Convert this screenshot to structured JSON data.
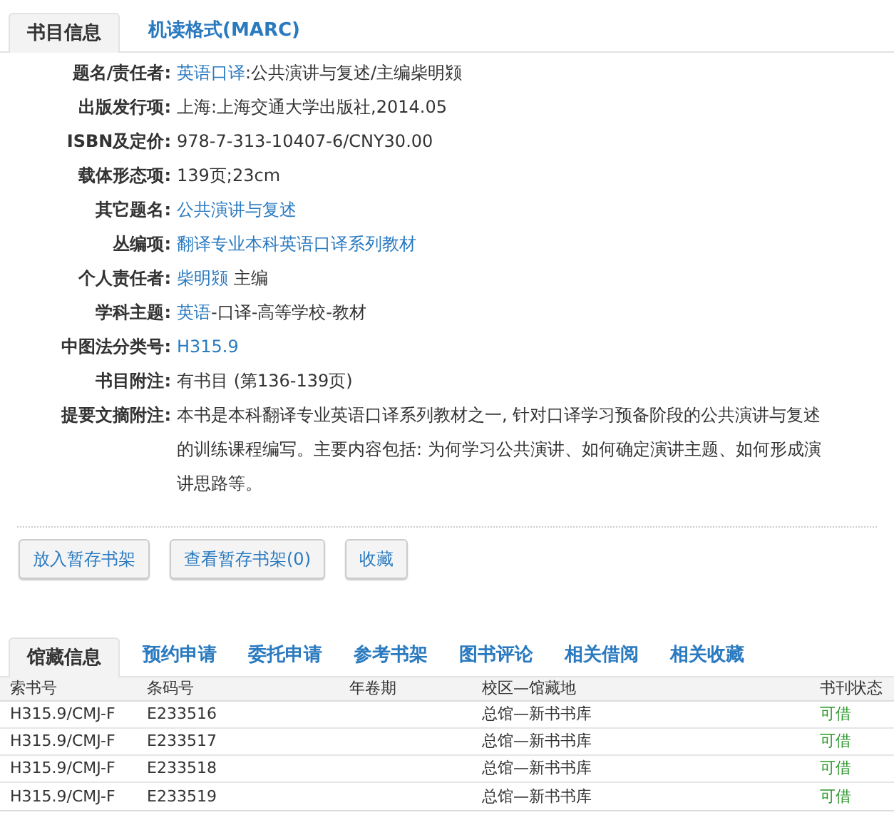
{
  "top_tabs": [
    {
      "label": "书目信息",
      "selected": true
    },
    {
      "label": "机读格式(MARC)",
      "selected": false
    }
  ],
  "fields": [
    {
      "label": "题名/责任者:",
      "value": [
        {
          "text": "英语口译",
          "link": true
        },
        {
          "text": ":公共演讲与复述/主编柴明颎",
          "link": false
        }
      ]
    },
    {
      "label": "出版发行项:",
      "value": [
        {
          "text": "上海:上海交通大学出版社,2014.05",
          "link": false
        }
      ]
    },
    {
      "label": "ISBN及定价:",
      "value": [
        {
          "text": "978-7-313-10407-6/CNY30.00",
          "link": false
        }
      ]
    },
    {
      "label": "载体形态项:",
      "value": [
        {
          "text": "139页;23cm",
          "link": false
        }
      ]
    },
    {
      "label": "其它题名:",
      "value": [
        {
          "text": "公共演讲与复述",
          "link": true
        }
      ]
    },
    {
      "label": "丛编项:",
      "value": [
        {
          "text": "翻译专业本科英语口译系列教材",
          "link": true
        }
      ]
    },
    {
      "label": "个人责任者:",
      "value": [
        {
          "text": "柴明颎",
          "link": true
        },
        {
          "text": " 主编",
          "link": false
        }
      ]
    },
    {
      "label": "学科主题:",
      "value": [
        {
          "text": "英语",
          "link": true
        },
        {
          "text": "-口译-高等学校-教材",
          "link": false
        }
      ]
    },
    {
      "label": "中图法分类号:",
      "value": [
        {
          "text": "H315.9",
          "link": true
        }
      ]
    },
    {
      "label": "书目附注:",
      "value": [
        {
          "text": "有书目 (第136-139页)",
          "link": false
        }
      ]
    },
    {
      "label": "提要文摘附注:",
      "value": [
        {
          "text": "本书是本科翻译专业英语口译系列教材之一, 针对口译学习预备阶段的公共演讲与复述的训练课程编写。主要内容包括: 为何学习公共演讲、如何确定演讲主题、如何形成演讲思路等。",
          "link": false
        }
      ]
    }
  ],
  "buttons": [
    "放入暂存书架",
    "查看暂存书架(0)",
    "收藏"
  ],
  "holding_tabs": [
    {
      "label": "馆藏信息",
      "selected": true
    },
    {
      "label": "预约申请",
      "selected": false
    },
    {
      "label": "委托申请",
      "selected": false
    },
    {
      "label": "参考书架",
      "selected": false
    },
    {
      "label": "图书评论",
      "selected": false
    },
    {
      "label": "相关借阅",
      "selected": false
    },
    {
      "label": "相关收藏",
      "selected": false
    }
  ],
  "table": {
    "columns": [
      "索书号",
      "条码号",
      "年卷期",
      "校区—馆藏地",
      "书刊状态"
    ],
    "rows": [
      [
        "H315.9/CMJ-F",
        "E233516",
        "",
        "总馆—新书书库",
        "可借"
      ],
      [
        "H315.9/CMJ-F",
        "E233517",
        "",
        "总馆—新书书库",
        "可借"
      ],
      [
        "H315.9/CMJ-F",
        "E233518",
        "",
        "总馆—新书书库",
        "可借"
      ],
      [
        "H315.9/CMJ-F",
        "E233519",
        "",
        "总馆—新书书库",
        "可借"
      ]
    ]
  }
}
